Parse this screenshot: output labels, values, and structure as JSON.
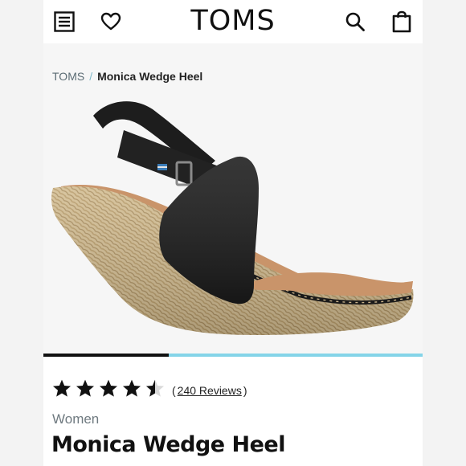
{
  "header": {
    "brand": "TOMS",
    "menu_icon": "menu-list-icon",
    "wishlist_icon": "heart-icon",
    "search_icon": "search-icon",
    "bag_icon": "shopping-bag-icon"
  },
  "breadcrumb": {
    "home": "TOMS",
    "separator": "/",
    "current": "Monica Wedge Heel"
  },
  "product": {
    "rating": 4.5,
    "rating_max": 5,
    "reviews_open": "(",
    "reviews_label": "240 Reviews",
    "reviews_close": ")",
    "category": "Women",
    "name": "Monica Wedge Heel",
    "gallery_position": 1,
    "gallery_count": 3
  },
  "colors": {
    "accent": "#84d4e8",
    "text": "#111111",
    "muted": "#6f7a80"
  }
}
